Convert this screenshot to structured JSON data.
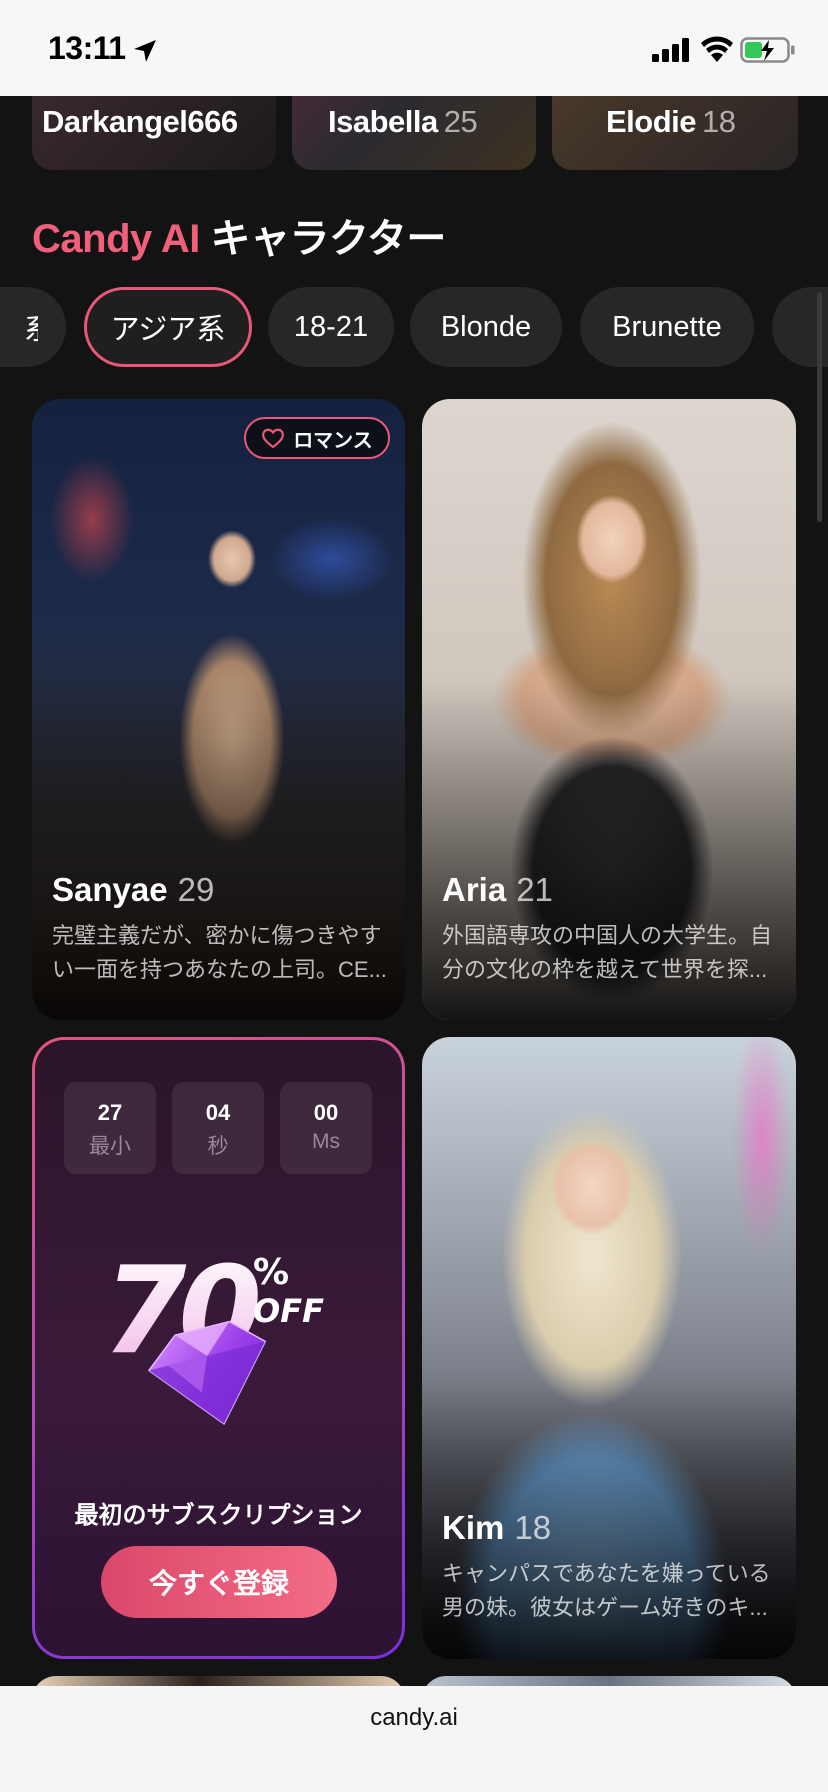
{
  "status_bar": {
    "time": "13:11"
  },
  "top_strip": [
    {
      "name": "Darkangel666",
      "age": ""
    },
    {
      "name": "Isabella",
      "age": "25"
    },
    {
      "name": "Elodie",
      "age": "18"
    }
  ],
  "section": {
    "brand": "Candy AI",
    "title": "キャラクター"
  },
  "chips": [
    {
      "label": "系"
    },
    {
      "label": "アジア系"
    },
    {
      "label": "18-21"
    },
    {
      "label": "Blonde"
    },
    {
      "label": "Brunette"
    }
  ],
  "cards": [
    {
      "name": "Sanyae",
      "age": "29",
      "tag": "ロマンス",
      "desc": "完璧主義だが、密かに傷つきやすい一面を持つあなたの上司。CE..."
    },
    {
      "name": "Aria",
      "age": "21",
      "desc": "外国語専攻の中国人の大学生。自分の文化の枠を越えて世界を探..."
    },
    {
      "name": "Kim",
      "age": "18",
      "desc": "キャンパスであなたを嫌っている男の妹。彼女はゲーム好きのキ..."
    }
  ],
  "promo": {
    "timer": [
      {
        "value": "27",
        "unit": "最小"
      },
      {
        "value": "04",
        "unit": "秒"
      },
      {
        "value": "00",
        "unit": "Ms"
      }
    ],
    "discount": "70",
    "percent": "%",
    "off": "OFF",
    "caption": "最初のサブスクリプション",
    "button": "今すぐ登録"
  },
  "browser": {
    "url": "candy.ai"
  },
  "colors": {
    "accent": "#e9577a",
    "background": "#131313",
    "chip": "#272727"
  }
}
